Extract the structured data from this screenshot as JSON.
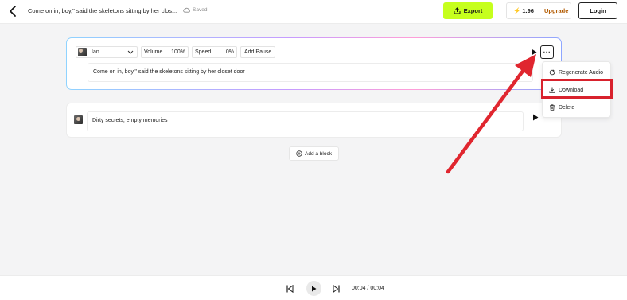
{
  "header": {
    "title": "Come on in, boy,\" said the skeletons sitting by her clos...",
    "saved_label": "Saved",
    "export_label": "Export",
    "credits": "1.96",
    "upgrade_label": "Upgrade",
    "login_label": "Login"
  },
  "block1": {
    "voice_name": "Ian",
    "volume_label": "Volume",
    "volume_value": "100%",
    "speed_label": "Speed",
    "speed_value": "0%",
    "add_pause_label": "Add Pause",
    "text": "Come on in, boy,\" said the skeletons sitting by her closet door",
    "more_label": "···"
  },
  "block2": {
    "text": "Dirty secrets, empty memories"
  },
  "add_block_label": "Add a block",
  "menu": {
    "items": [
      {
        "label": "Regenerate Audio",
        "icon": "refresh-icon"
      },
      {
        "label": "Download",
        "icon": "download-icon"
      },
      {
        "label": "Delete",
        "icon": "trash-icon"
      }
    ]
  },
  "player": {
    "time": "00:04 / 00:04"
  },
  "colors": {
    "accent_export": "#c6ff1d",
    "annotation_red": "#d8222d",
    "upgrade_text": "#b25a00"
  }
}
